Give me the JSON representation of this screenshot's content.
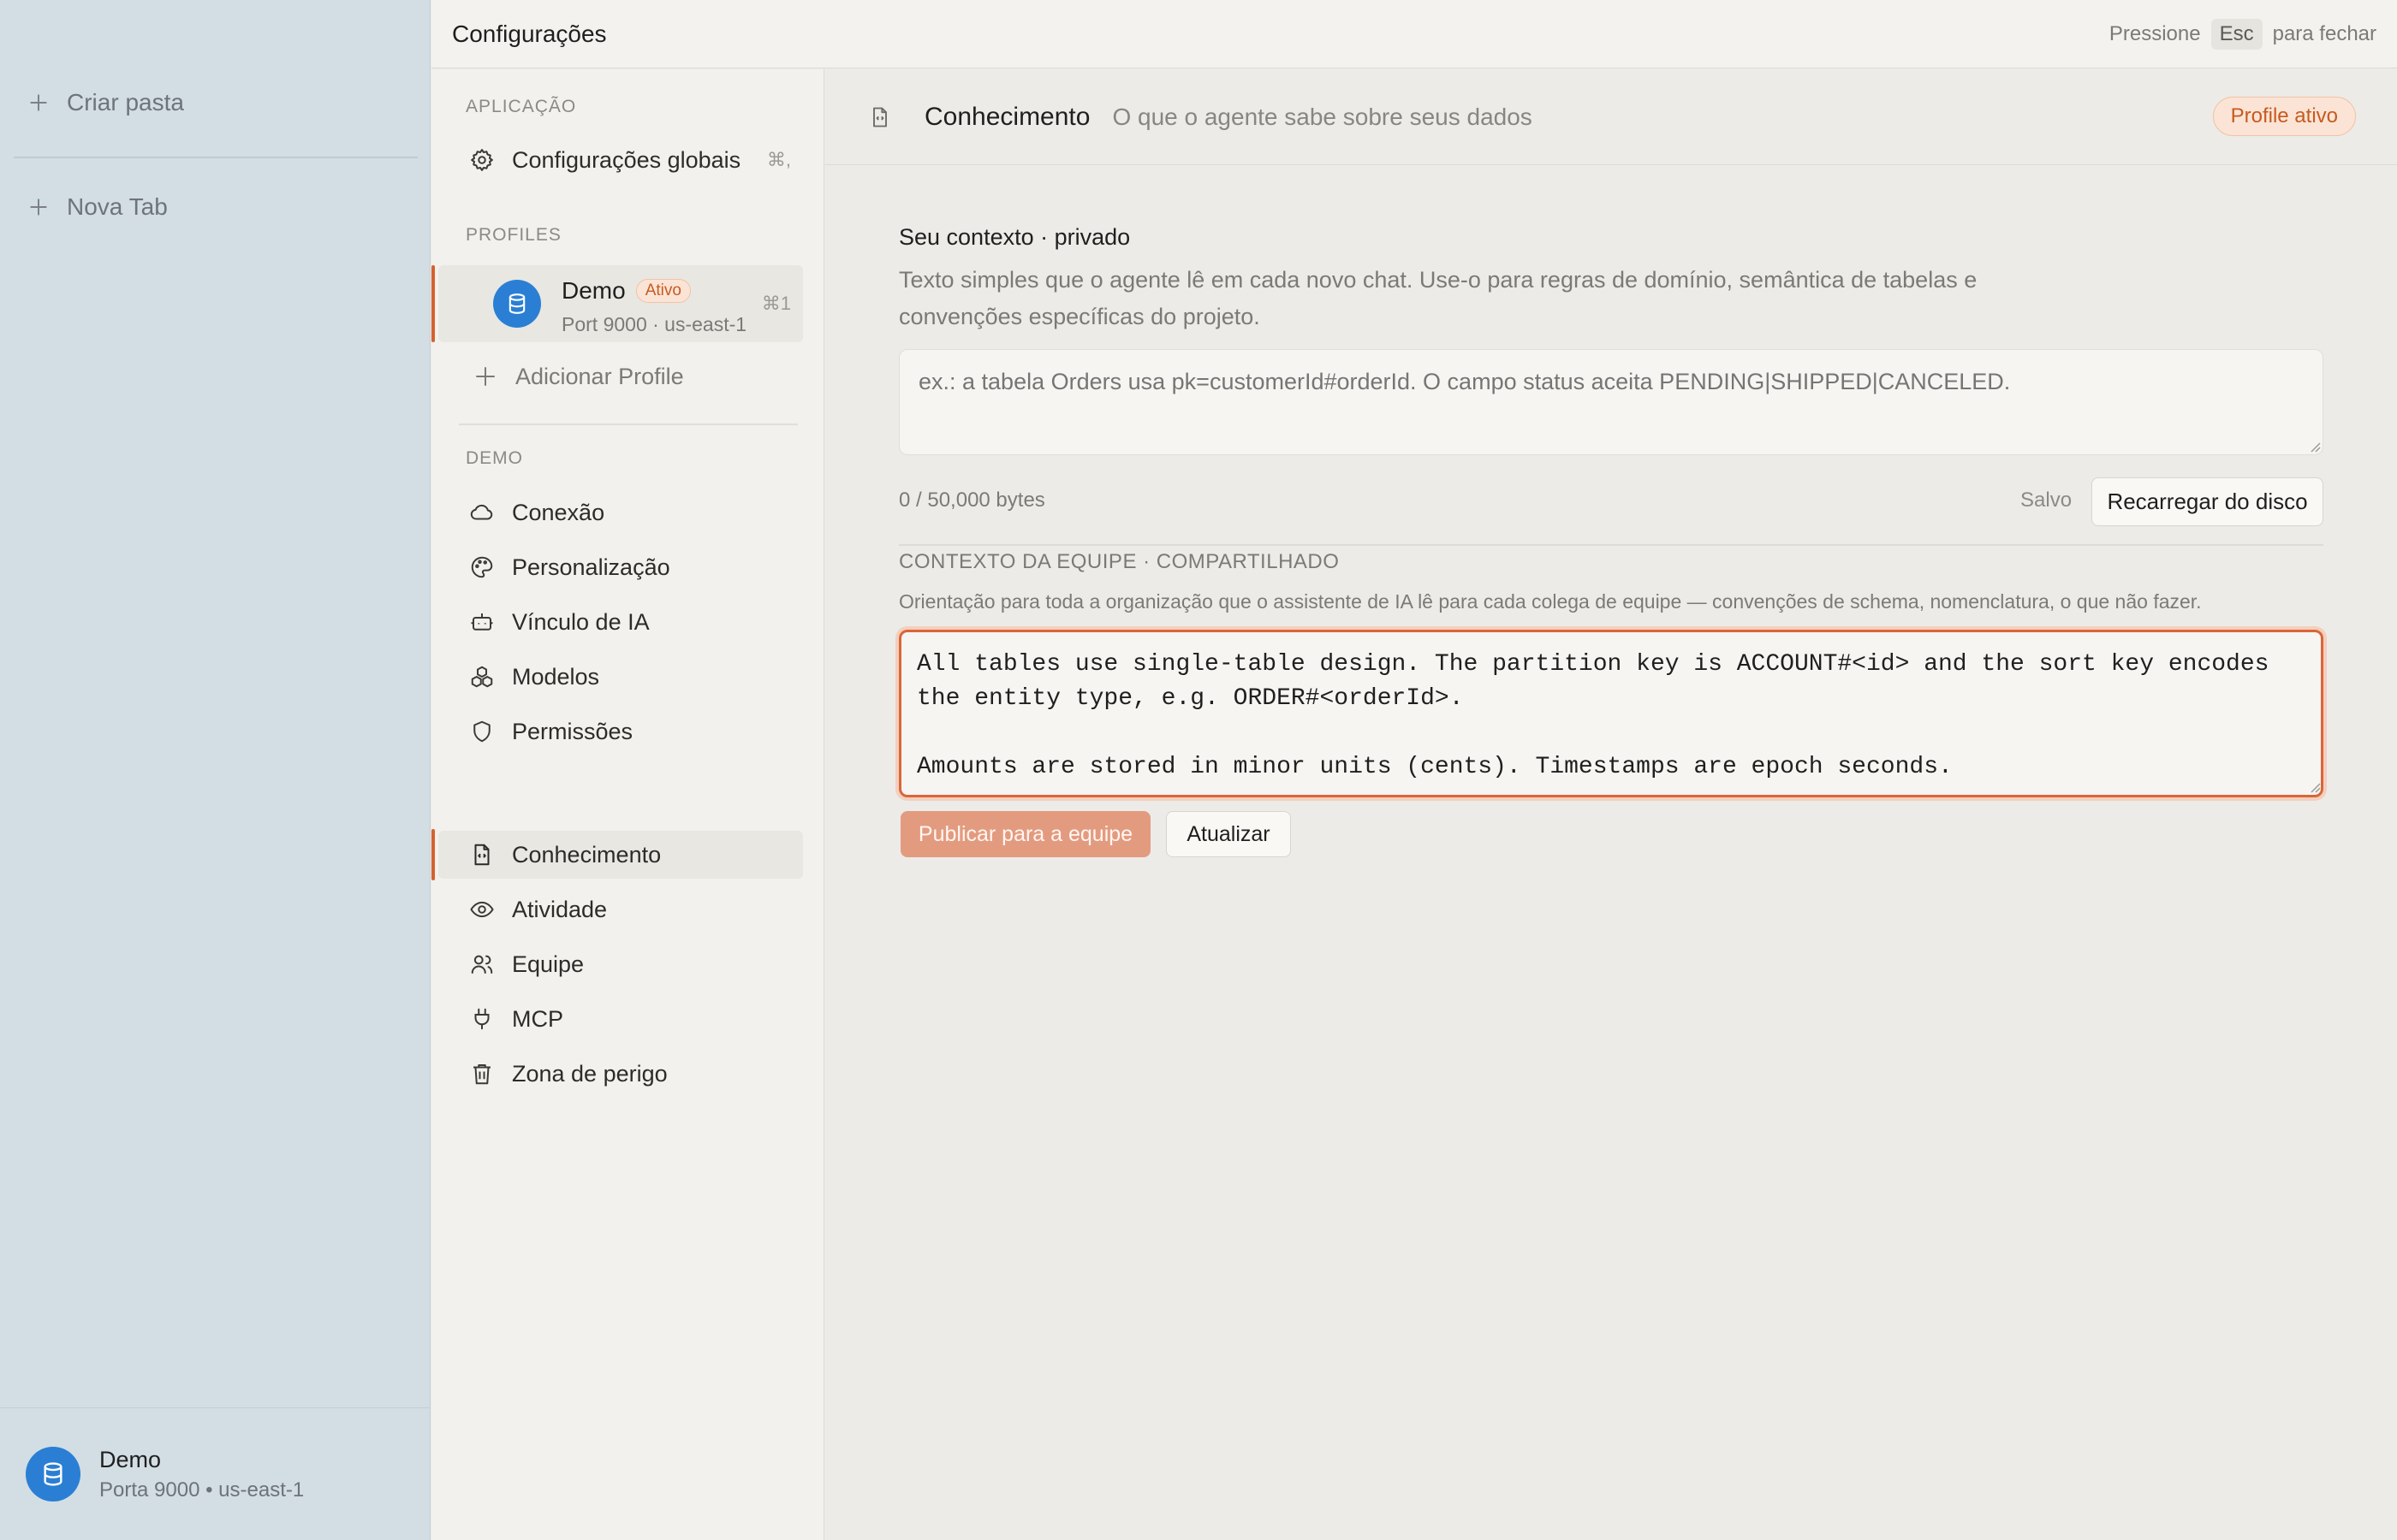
{
  "app_sidebar": {
    "create_folder": "Criar pasta",
    "new_tab": "Nova Tab",
    "footer": {
      "name": "Demo",
      "subtitle": "Porta 9000 • us-east-1"
    }
  },
  "header": {
    "title": "Configurações",
    "esc_prefix": "Pressione",
    "esc_key": "Esc",
    "esc_suffix": "para fechar"
  },
  "nav": {
    "app_section": "APLICAÇÃO",
    "global_settings": {
      "label": "Configurações globais",
      "shortcut": "⌘,"
    },
    "profiles_section": "PROFILES",
    "profile": {
      "name": "Demo",
      "badge": "Ativo",
      "subtitle": "Port 9000 · us-east-1",
      "shortcut": "⌘1"
    },
    "add_profile": "Adicionar Profile",
    "demo_section": "DEMO",
    "items": [
      {
        "label": "Conexão",
        "icon": "cloud-icon"
      },
      {
        "label": "Personalização",
        "icon": "palette-icon"
      },
      {
        "label": "Vínculo de IA",
        "icon": "bot-icon"
      },
      {
        "label": "Modelos",
        "icon": "boxes-icon"
      },
      {
        "label": "Permissões",
        "icon": "shield-icon"
      },
      {
        "label": "Conhecimento",
        "icon": "file-code-icon",
        "active": true
      },
      {
        "label": "Atividade",
        "icon": "eye-icon"
      },
      {
        "label": "Equipe",
        "icon": "users-icon"
      },
      {
        "label": "MCP",
        "icon": "plug-icon"
      },
      {
        "label": "Zona de perigo",
        "icon": "trash-icon"
      }
    ]
  },
  "content": {
    "title": "Conhecimento",
    "subtitle": "O que o agente sabe sobre seus dados",
    "profile_badge": "Profile ativo",
    "private": {
      "title": "Seu contexto · privado",
      "description": "Texto simples que o agente lê em cada novo chat. Use-o para regras de domínio, semântica de tabelas e convenções específicas do projeto.",
      "placeholder": "ex.: a tabela Orders usa pk=customerId#orderId. O campo status aceita PENDING|SHIPPED|CANCELED.",
      "value": "",
      "byte_count": "0 / 50,000 bytes",
      "status": "Salvo",
      "reload_button": "Recarregar do disco"
    },
    "team": {
      "title": "CONTEXTO DA EQUIPE · COMPARTILHADO",
      "description": "Orientação para toda a organização que o assistente de IA lê para cada colega de equipe — convenções de schema, nomenclatura, o que não fazer.",
      "value": "All tables use single-table design. The partition key is ACCOUNT#<id> and the sort key encodes\nthe entity type, e.g. ORDER#<orderId>.\n\nAmounts are stored in minor units (cents). Timestamps are epoch seconds.",
      "publish_button": "Publicar para a equipe",
      "refresh_button": "Atualizar"
    }
  },
  "colors": {
    "accent": "#d4622e",
    "sidebar_bg": "#d3dde4",
    "avatar_blue": "#2a7fd4",
    "publish_button": "#e39b80"
  }
}
